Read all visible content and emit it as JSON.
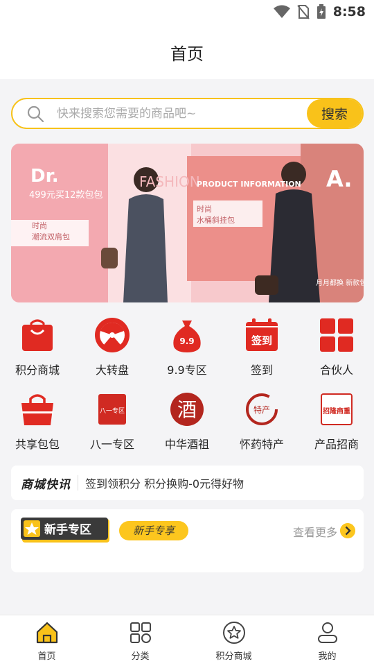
{
  "status_bar": {
    "time": "8:58"
  },
  "header": {
    "title": "首页"
  },
  "search": {
    "placeholder": "快来搜索您需要的商品吧~",
    "button_label": "搜索"
  },
  "banner": {
    "left_brand": "Dr.",
    "left_promo": "499元买12款包包",
    "left_tag": "时尚",
    "left_sub": "潮流双肩包",
    "middle_text": "FASHION",
    "right_heading": "PRODUCT INFORMATION",
    "right_tag": "时尚",
    "right_sub": "水桶斜挂包",
    "right_brand": "A.",
    "right_promo": "月月都换 新款包包"
  },
  "categories": [
    {
      "label": "积分商城",
      "icon": "shopping-bag-icon"
    },
    {
      "label": "大转盘",
      "icon": "wheel-icon"
    },
    {
      "label": "9.9专区",
      "icon": "money-bag-icon",
      "icon_text": "9.9"
    },
    {
      "label": "签到",
      "icon": "calendar-icon",
      "icon_text": "签到"
    },
    {
      "label": "合伙人",
      "icon": "grid-icon"
    },
    {
      "label": "共享包包",
      "icon": "handbag-icon"
    },
    {
      "label": "八一专区",
      "icon": "stamp-icon",
      "icon_text": "八一专区"
    },
    {
      "label": "中华酒祖",
      "icon": "wine-icon",
      "icon_text": "酒"
    },
    {
      "label": "怀药特产",
      "icon": "herb-icon",
      "icon_text": "特产"
    },
    {
      "label": "产品招商",
      "icon": "recruit-icon",
      "icon_text": "招隆商重"
    }
  ],
  "news": {
    "brand": "商城快讯",
    "text": "签到领积分 积分换购-0元得好物"
  },
  "novice": {
    "title": "新手专区",
    "pill": "新手专享",
    "more": "查看更多"
  },
  "tabbar": [
    {
      "label": "首页",
      "icon": "home-icon"
    },
    {
      "label": "分类",
      "icon": "category-icon"
    },
    {
      "label": "积分商城",
      "icon": "star-icon"
    },
    {
      "label": "我的",
      "icon": "user-icon"
    }
  ],
  "colors": {
    "accent": "#f9c21a",
    "icon_red": "#e02a22"
  }
}
